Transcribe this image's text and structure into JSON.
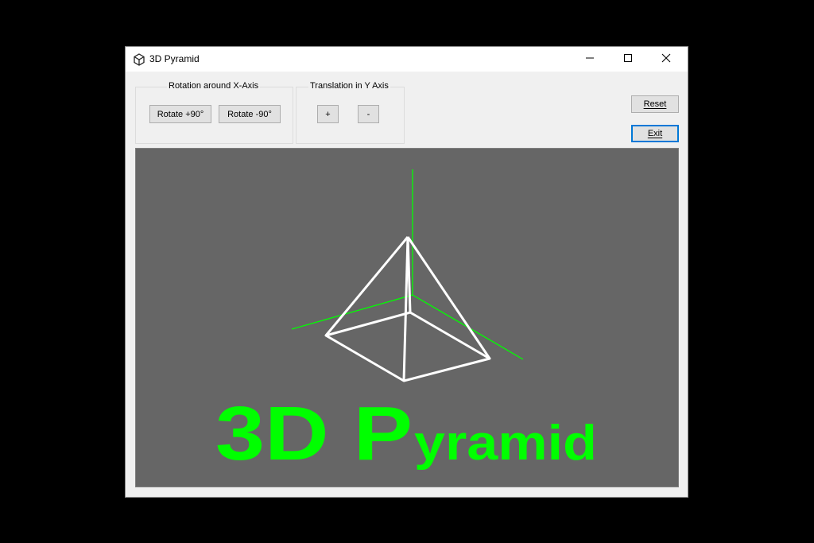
{
  "window": {
    "title": "3D Pyramid",
    "app_icon": "cube-icon",
    "controls": [
      "minimize-icon",
      "maximize-icon",
      "close-icon"
    ]
  },
  "rotation_group": {
    "legend": "Rotation around X-Axis",
    "rotate_plus_label": "Rotate +90°",
    "rotate_minus_label": "Rotate -90°"
  },
  "translation_group": {
    "legend": "Translation in Y Axis",
    "plus_label": "+",
    "minus_label": "-"
  },
  "actions": {
    "reset_label": "Reset",
    "exit_label": "Exit"
  },
  "canvas": {
    "background": "#666666",
    "axis_color": "#00ff00",
    "pyramid_color": "#ffffff",
    "banner_prefix": "3D P",
    "banner_suffix": "yramid",
    "banner_color": "#00ff00"
  }
}
